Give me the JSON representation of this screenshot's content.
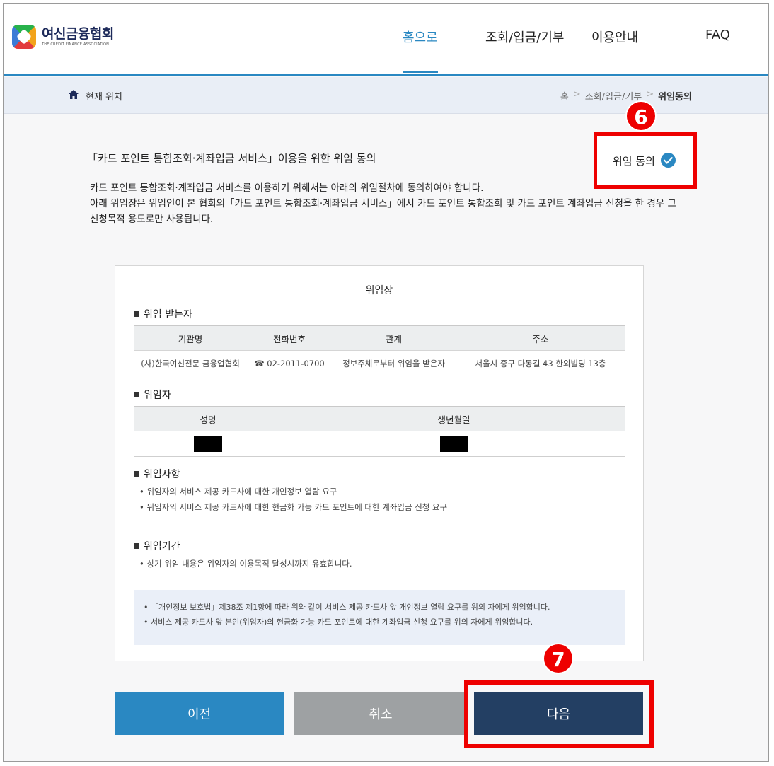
{
  "logo": {
    "name_ko": "여신금융협회",
    "name_en": "THE CREDIT FINANCE ASSOCIATION"
  },
  "nav": {
    "items": [
      "홈으로",
      "조회/입금/기부",
      "이용안내",
      "FAQ"
    ],
    "active_index": 0
  },
  "breadcrumb": {
    "here_label": "현재 위치",
    "path": [
      "홈",
      "조회/입금/기부",
      "위임동의"
    ]
  },
  "intro": {
    "title": "「카드 포인트 통합조회·계좌입금 서비스」이용을 위한 위임 동의",
    "desc_line1": "카드 포인트 통합조회·계좌입금 서비스를 이용하기 위해서는 아래의 위임절차에 동의하여야 합니다.",
    "desc_line2": "아래 위임장은 위임인이 본 협회의「카드 포인트 통합조회·계좌입금 서비스」에서 카드 포인트 통합조회 및 카드 포인트 계좌입금 신청을 한 경우 그 신청목적 용도로만 사용됩니다."
  },
  "agree": {
    "label": "위임 동의",
    "checked": true
  },
  "annotations": {
    "badge_6": "6",
    "badge_7": "7",
    "highlight_color": "#e00000"
  },
  "document": {
    "title": "위임장",
    "recipient": {
      "section_title": "위임 받는자",
      "headers": [
        "기관명",
        "전화번호",
        "관계",
        "주소"
      ],
      "row": [
        "(사)한국여신전문 금융업협회",
        "☎ 02-2011-0700",
        "정보주체로부터 위임을 받은자",
        "서울시 중구 다동길 43 한외빌딩 13층"
      ]
    },
    "delegator": {
      "section_title": "위임자",
      "headers": [
        "성명",
        "생년월일"
      ]
    },
    "matters": {
      "section_title": "위임사항",
      "items": [
        "위임자의 서비스 제공 카드사에 대한 개인정보 열람 요구",
        "위임자의 서비스 제공 카드사에 대한 현금화 가능 카드 포인트에 대한 계좌입금 신청 요구"
      ]
    },
    "period": {
      "section_title": "위임기간",
      "items": [
        "상기 위임 내용은 위임자의 이용목적 달성시까지 유효합니다."
      ]
    },
    "notice": [
      "「개인정보 보호법」제38조 제1항에 따라 위와 같이 서비스 제공 카드사 앞 개인정보 열람 요구를 위의 자에게 위임합니다.",
      "서비스 제공 카드사 앞 본인(위임자)의 현금화 가능 카드 포인트에 대한 계좌입금 신청 요구를 위의 자에게 위임합니다."
    ]
  },
  "buttons": {
    "prev": "이전",
    "cancel": "취소",
    "next": "다음"
  },
  "colors": {
    "accent": "#2a88c2",
    "next_button": "#233f63",
    "cancel_button": "#9ea1a3"
  }
}
